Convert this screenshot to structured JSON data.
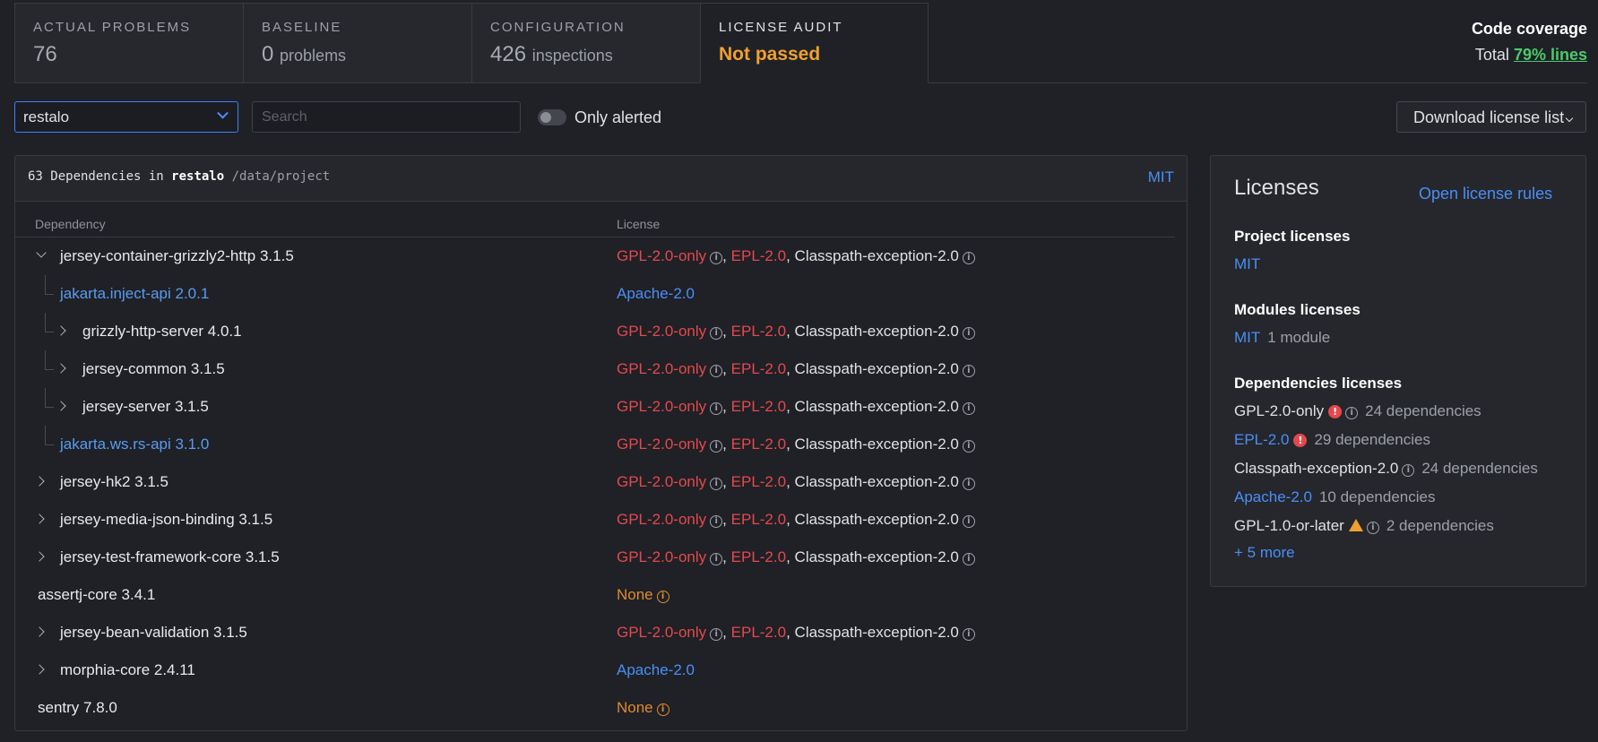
{
  "tabs": [
    {
      "title": "Actual problems",
      "num": "76",
      "unit": ""
    },
    {
      "title": "Baseline",
      "num": "0",
      "unit": "problems"
    },
    {
      "title": "Configuration",
      "num": "426",
      "unit": "inspections"
    },
    {
      "title": "License audit",
      "status": "Not passed"
    }
  ],
  "coverage": {
    "title": "Code coverage",
    "prefix": "Total",
    "link": "79% lines"
  },
  "toolbar": {
    "module_select": "restalo",
    "search_placeholder": "Search",
    "only_alerted_label": "Only alerted",
    "download_label": "Download license list"
  },
  "deps_panel": {
    "count_text": "63 Dependencies in",
    "module": "restalo",
    "path": "/data/project",
    "project_license": "MIT",
    "col_dependency": "Dependency",
    "col_license": "License"
  },
  "common": {
    "gpl": "GPL-2.0-only",
    "epl": "EPL-2.0",
    "cpe": "Classpath-exception-2.0",
    "apache": "Apache-2.0",
    "none": "None",
    "comma": ","
  },
  "rows": [
    {
      "name": "jersey-container-grizzly2-http 3.1.5"
    },
    {
      "name": "jakarta.inject-api 2.0.1"
    },
    {
      "name": "grizzly-http-server 4.0.1"
    },
    {
      "name": "jersey-common 3.1.5"
    },
    {
      "name": "jersey-server 3.1.5"
    },
    {
      "name": "jakarta.ws.rs-api 3.1.0"
    },
    {
      "name": "jersey-hk2 3.1.5"
    },
    {
      "name": "jersey-media-json-binding 3.1.5"
    },
    {
      "name": "jersey-test-framework-core 3.1.5"
    },
    {
      "name": "assertj-core 3.4.1"
    },
    {
      "name": "jersey-bean-validation 3.1.5"
    },
    {
      "name": "morphia-core 2.4.11"
    },
    {
      "name": "sentry 7.8.0"
    }
  ],
  "licenses_panel": {
    "title": "Licenses",
    "open_rules": "Open license rules",
    "project_title": "Project licenses",
    "project_license": "MIT",
    "modules_title": "Modules licenses",
    "modules_license": "MIT",
    "modules_count": "1 module",
    "deps_title": "Dependencies licenses",
    "deps": [
      {
        "name": "GPL-2.0-only",
        "count": "24 dependencies"
      },
      {
        "name": "EPL-2.0",
        "count": "29 dependencies"
      },
      {
        "name": "Classpath-exception-2.0",
        "count": "24 dependencies"
      },
      {
        "name": "Apache-2.0",
        "count": "10 dependencies"
      },
      {
        "name": "GPL-1.0-or-later",
        "count": "2 dependencies"
      }
    ],
    "more": "+ 5 more"
  }
}
